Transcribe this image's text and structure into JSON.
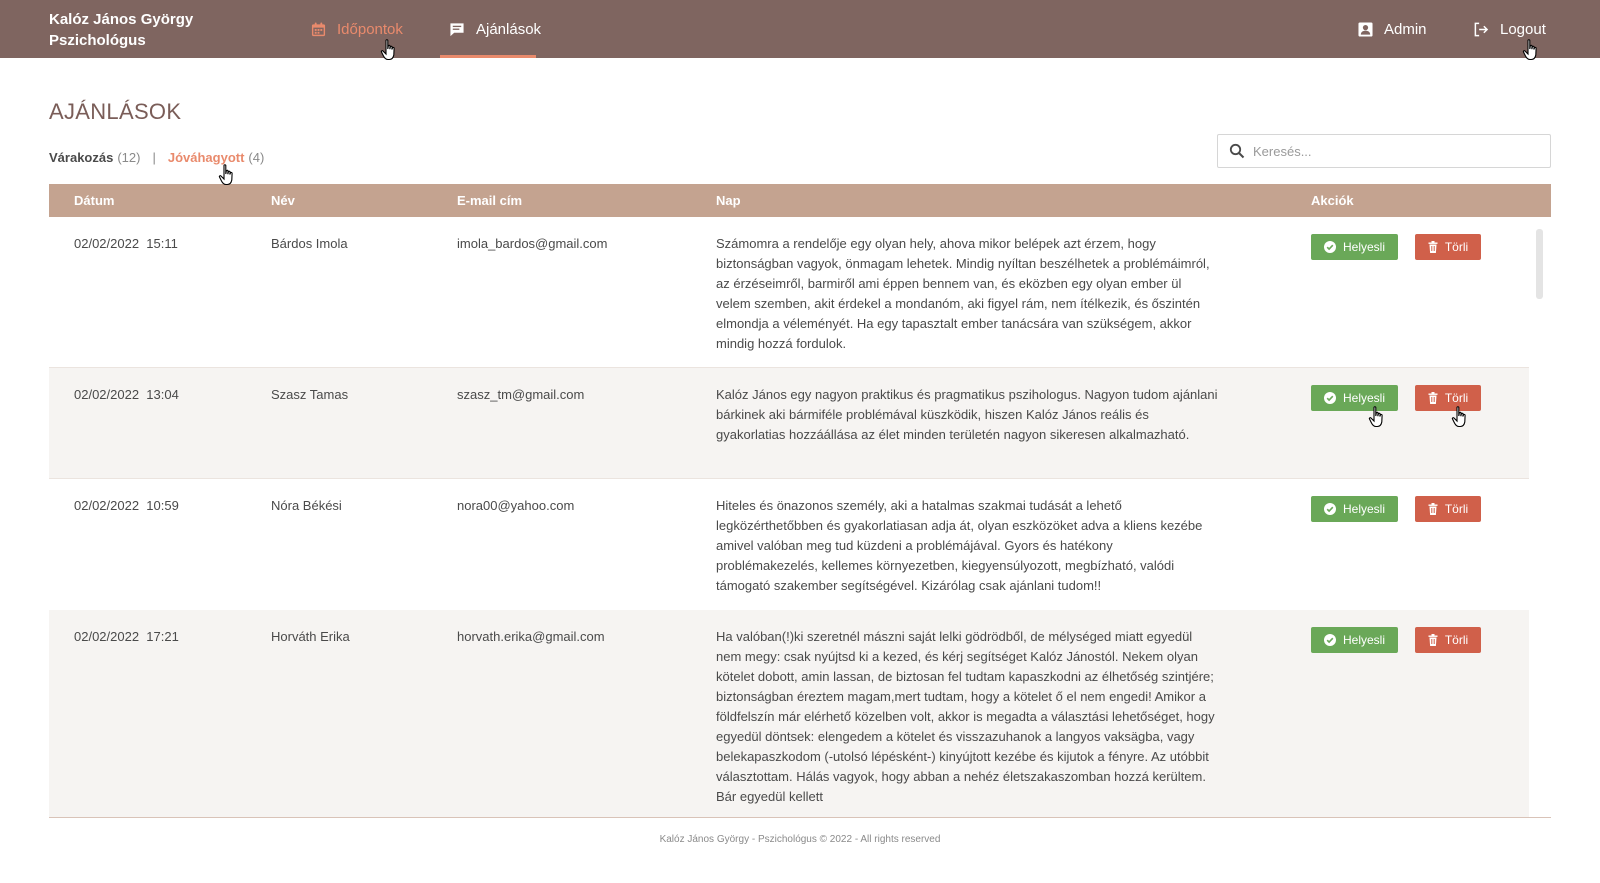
{
  "header": {
    "brand_line1": "Kalóz János György",
    "brand_line2": "Pszichológus",
    "nav": {
      "idopontok": "Időpontok",
      "ajanlasok": "Ajánlások",
      "admin": "Admin",
      "logout": "Logout"
    },
    "icons": [
      "calendar-icon",
      "comment-icon",
      "user-icon",
      "logout-icon"
    ]
  },
  "page": {
    "title": "AJÁNLÁSOK",
    "filters": {
      "waiting_label": "Várakozás",
      "waiting_count": "(12)",
      "separator": "|",
      "approved_label": "Jóváhagyott",
      "approved_count": "(4)"
    },
    "search": {
      "placeholder": "Keresés..."
    }
  },
  "table": {
    "columns": [
      "Dátum",
      "Név",
      "E-mail cím",
      "Nap",
      "Akciók"
    ],
    "approve_label": "Helyesli",
    "delete_label": "Törli",
    "rows": [
      {
        "date": "02/02/2022  15:11",
        "name": "Bárdos Imola",
        "email": "imola_bardos@gmail.com",
        "text": "Számomra a rendelője egy olyan hely, ahova mikor belépek azt érzem, hogy biztonságban vagyok, önmagam lehetek. Mindig nyíltan beszélhetek a problémáimról, az érzéseimről, barmiről ami éppen bennem van, és eközben egy olyan ember ül velem szemben, akit érdekel a mondanóm, aki figyel rám, nem ítélkezik, és őszintén elmondja a véleményét. Ha egy tapasztalt ember tanácsára van szükségem, akkor mindig hozzá fordulok."
      },
      {
        "date": "02/02/2022  13:04",
        "name": "Szasz Tamas",
        "email": "szasz_tm@gmail.com",
        "text": "Kalóz János egy nagyon praktikus és pragmatikus pszihologus. Nagyon tudom ajánlani bárkinek aki bármiféle problémával küszködik, hiszen Kalóz János reális és gyakorlatias hozzáállása az élet minden területén nagyon sikeresen alkalmazható."
      },
      {
        "date": "02/02/2022  10:59",
        "name": "Nóra Békési",
        "email": "nora00@yahoo.com",
        "text": "Hiteles és önazonos személy, aki a hatalmas szakmai tudását a lehető legközérthetőbben és gyakorlatiasan adja át, olyan eszközöket adva a kliens kezébe amivel valóban meg tud küzdeni a problémájával. Gyors és hatékony problémakezelés, kellemes környezetben, kiegyensúlyozott, megbízható, valódi támogató szakember segítségével. Kizárólag csak ajánlani tudom!!"
      },
      {
        "date": "02/02/2022  17:21",
        "name": "Horváth Erika",
        "email": "horvath.erika@gmail.com",
        "text": "Ha valóban(!)ki szeretnél mászni saját lelki gödrödből, de mélységed miatt egyedül nem megy: csak nyújtsd ki a kezed, és kérj segítséget Kalóz Jánostól. Nekem olyan kötelet dobott, amin lassan, de biztosan fel tudtam kapaszkodni az élhetőség szintjére; biztonságban éreztem magam,mert tudtam, hogy a kötelet ő el nem engedi! Amikor a földfelszín már elérhető közelben volt, akkor is megadta a választási lehetőséget, hogy egyedül döntsek: elengedem a kötelet és visszazuhanok a langyos vaksägba, vagy belekapaszkodom (-utolsó lépésként-) kinyújtott kezébe és kijutok a fényre. Az utóbbit választottam. Hálás vagyok, hogy abban a nehéz életszakaszomban hozzá kerültem. Bár egyedül kellett"
      }
    ]
  },
  "footer": {
    "text": "Kalóz János György - Pszichológus © 2022 - All rights reserved"
  },
  "colors": {
    "header_bg": "#7f6560",
    "accent": "#e98a6c",
    "table_header_bg": "#c4a390",
    "approve": "#6aa858",
    "delete": "#d0604a"
  }
}
